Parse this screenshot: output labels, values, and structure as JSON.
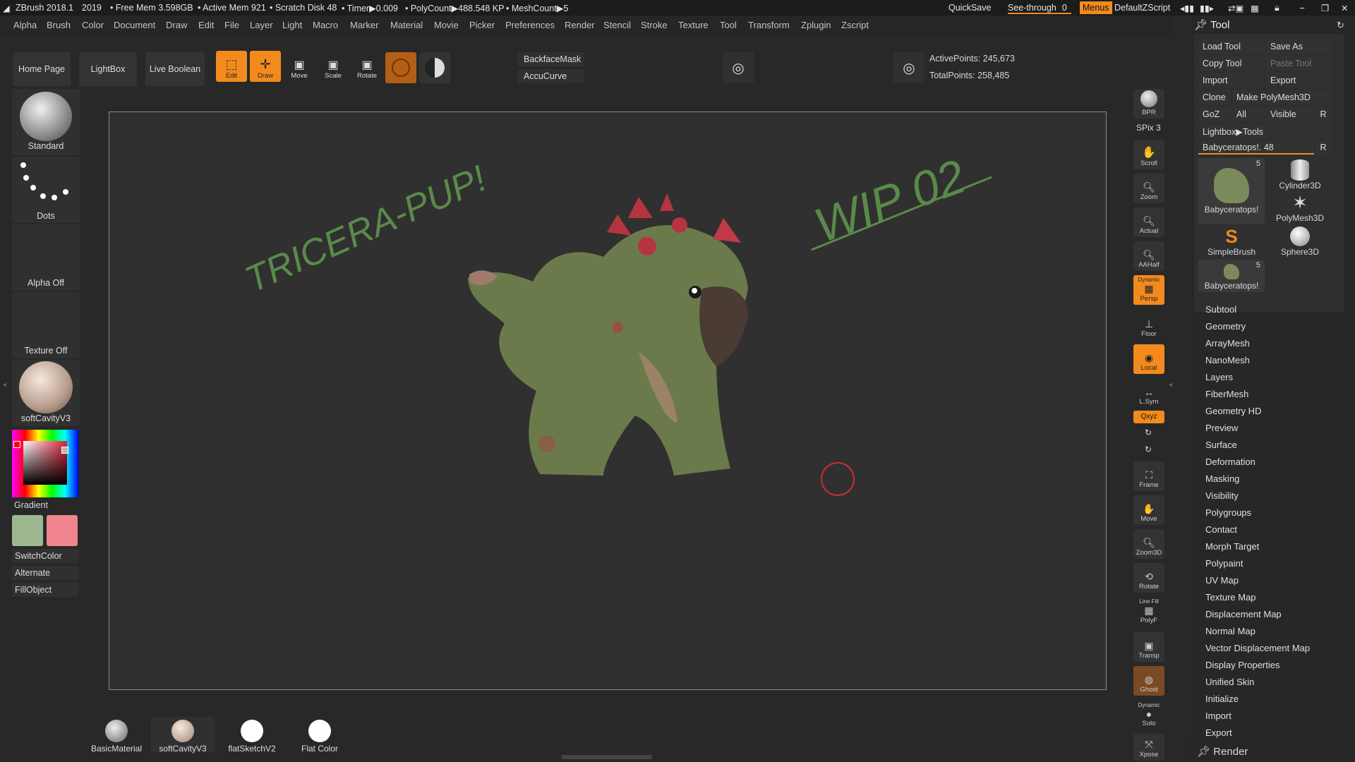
{
  "titlebar": {
    "app": "ZBrush 2018.1",
    "year": "2019",
    "free_mem": "• Free Mem 3.598GB",
    "active_mem": "• Active Mem 921",
    "scratch": "• Scratch Disk 48",
    "timer": "• Timer▶0.009",
    "polycount": "• PolyCount▶488.548 KP",
    "meshcount": "• MeshCount▶5",
    "quicksave": "QuickSave",
    "seethrough": "See-through",
    "seethrough_val": "0",
    "menus": "Menus",
    "script": "DefaultZScript"
  },
  "menubar": [
    "Alpha",
    "Brush",
    "Color",
    "Document",
    "Draw",
    "Edit",
    "File",
    "Layer",
    "Light",
    "Macro",
    "Marker",
    "Material",
    "Movie",
    "Picker",
    "Preferences",
    "Render",
    "Stencil",
    "Stroke",
    "Texture",
    "Tool",
    "Transform",
    "Zplugin",
    "Zscript"
  ],
  "shelf": {
    "home": "Home Page",
    "lightbox": "LightBox",
    "liveboolean": "Live Boolean",
    "edit": "Edit",
    "draw": "Draw",
    "move": "Move",
    "scale": "Scale",
    "rotate": "Rotate",
    "backface": "BackfaceMask",
    "accucurve": "AccuCurve",
    "active_points": "ActivePoints: 245,673",
    "total_points": "TotalPoints: 258,485"
  },
  "leftpanel": {
    "brush": "Standard",
    "stroke": "Dots",
    "alpha": "Alpha Off",
    "texture": "Texture Off",
    "material": "softCavityV3",
    "gradient": "Gradient",
    "switchcolor": "SwitchColor",
    "alternate": "Alternate",
    "fillobject": "FillObject",
    "main_color": "#9db88f",
    "secondary_color": "#f0848f"
  },
  "viewport": {
    "text1": "TRICERA-PUP!",
    "text2": "WIP 02"
  },
  "rightstrip": {
    "bpr": "BPR",
    "spix": "SPix 3",
    "scroll": "Scroll",
    "zoom": "Zoom",
    "actual": "Actual",
    "aahalf": "AAHalf",
    "dynamic": "Dynamic",
    "persp": "Persp",
    "floor": "Floor",
    "local": "Local",
    "lsym": "L.Sym",
    "xyz": "Qxyz",
    "frame": "Frame",
    "move": "Move",
    "zoom3d": "Zoom3D",
    "rotate": "Rotate",
    "linefill": "Line Fill",
    "polyf": "PolyF",
    "transp": "Transp",
    "ghost": "Ghost",
    "dynamic2": "Dynamic",
    "solo": "Solo",
    "xpose": "Xpose"
  },
  "toolpanel": {
    "title": "Tool",
    "load": "Load Tool",
    "saveas": "Save As",
    "copy": "Copy Tool",
    "paste": "Paste Tool",
    "import": "Import",
    "export": "Export",
    "clone": "Clone",
    "makepoly": "Make PolyMesh3D",
    "goz": "GoZ",
    "all": "All",
    "visible": "Visible",
    "r": "R",
    "lightbox_tools": "Lightbox▶Tools",
    "current": "Babyceratops!. 48",
    "thumbs": [
      {
        "name": "Babyceratops!",
        "count": "5"
      },
      {
        "name": "Cylinder3D",
        "count": ""
      },
      {
        "name": "PolyMesh3D",
        "count": ""
      },
      {
        "name": "SimpleBrush",
        "count": ""
      },
      {
        "name": "Sphere3D",
        "count": ""
      },
      {
        "name": "Babyceratops!",
        "count": "5"
      }
    ],
    "subpalettes": [
      "Subtool",
      "Geometry",
      "ArrayMesh",
      "NanoMesh",
      "Layers",
      "FiberMesh",
      "Geometry HD",
      "Preview",
      "Surface",
      "Deformation",
      "Masking",
      "Visibility",
      "Polygroups",
      "Contact",
      "Morph Target",
      "Polypaint",
      "UV Map",
      "Texture Map",
      "Displacement Map",
      "Normal Map",
      "Vector Displacement Map",
      "Display Properties",
      "Unified Skin",
      "Initialize",
      "Import",
      "Export"
    ],
    "render": "Render"
  },
  "materials": [
    "BasicMaterial",
    "softCavityV3",
    "flatSketchV2",
    "Flat Color"
  ]
}
